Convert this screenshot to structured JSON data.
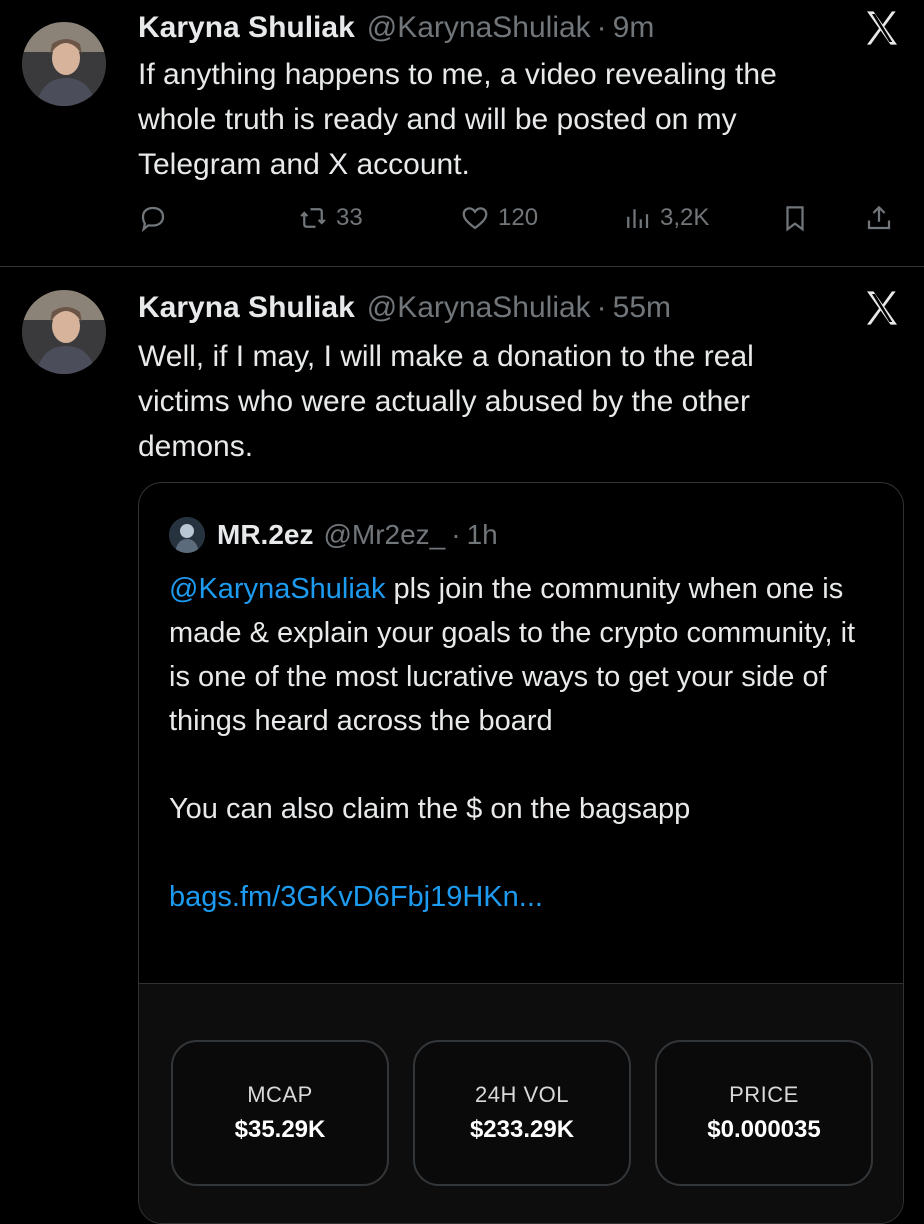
{
  "tweets": [
    {
      "author": {
        "name": "Karyna Shuliak",
        "handle": "@KarynaShuliak"
      },
      "time": "9m",
      "text": "If anything happens to me, a video revealing the\nwhole truth is ready and will be posted on my\nTelegram and X account.",
      "stats": {
        "retweets": "33",
        "likes": "120",
        "views": "3,2K"
      }
    },
    {
      "author": {
        "name": "Karyna Shuliak",
        "handle": "@KarynaShuliak"
      },
      "time": "55m",
      "text": "Well, if I may, I will make a donation to the real\nvictims who were actually abused by the other\ndemons.",
      "quote": {
        "author": {
          "name": "MR.2ez",
          "handle": "@Mr2ez_"
        },
        "time": "1h",
        "mention": "@KarynaShuliak",
        "text_1": " pls join the community when one is made & explain your goals to the crypto community, it is one of the most lucrative ways to get your side of things heard across the board",
        "text_2": "You can also claim the $ on the bagsapp",
        "link": "bags.fm/3GKvD6Fbj19HKn...",
        "card": [
          {
            "label": "MCAP",
            "value": "$35.29K"
          },
          {
            "label": "24H VOL",
            "value": "$233.29K"
          },
          {
            "label": "PRICE",
            "value": "$0.000035"
          }
        ]
      }
    }
  ],
  "icons": {
    "reply": "reply-icon",
    "retweet": "retweet-icon",
    "like": "heart-icon",
    "views": "views-icon",
    "bookmark": "bookmark-icon",
    "share": "share-icon",
    "platform": "x-logo-icon"
  },
  "colors": {
    "background": "#000000",
    "text": "#e7e9ea",
    "muted": "#71767b",
    "link": "#1d9bf0",
    "border": "#2f3336"
  }
}
